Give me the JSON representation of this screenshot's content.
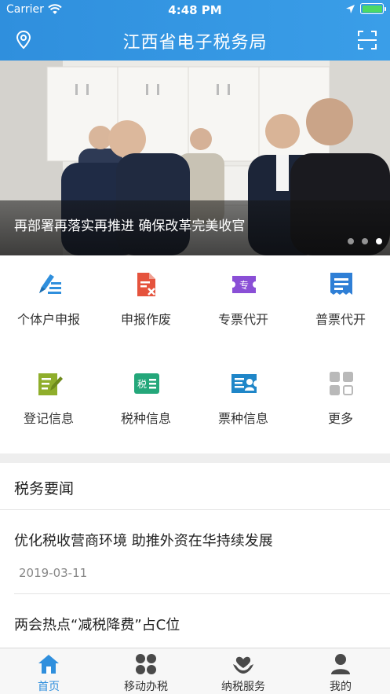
{
  "status_bar": {
    "carrier": "Carrier",
    "time": "4:48 PM"
  },
  "header": {
    "title": "江西省电子税务局",
    "left_icon": "location-pin-icon",
    "right_icon": "scan-icon"
  },
  "banner": {
    "caption": "再部署再落实再推进 确保改革完美收官",
    "slide_count": 3,
    "active_slide": 3
  },
  "services": [
    {
      "label": "个体户申报",
      "icon": "pen-form-icon"
    },
    {
      "label": "申报作废",
      "icon": "document-cancel-icon"
    },
    {
      "label": "专票代开",
      "icon": "special-ticket-icon"
    },
    {
      "label": "普票代开",
      "icon": "receipt-icon"
    },
    {
      "label": "登记信息",
      "icon": "register-edit-icon"
    },
    {
      "label": "税种信息",
      "icon": "tax-type-icon"
    },
    {
      "label": "票种信息",
      "icon": "ticket-type-icon"
    },
    {
      "label": "更多",
      "icon": "more-grid-icon"
    }
  ],
  "news": {
    "heading": "税务要闻",
    "items": [
      {
        "title": "优化税收营商环境 助推外资在华持续发展",
        "date": "2019-03-11"
      },
      {
        "title": "两会热点“减税降费”占C位"
      }
    ]
  },
  "tabs": [
    {
      "label": "首页",
      "icon": "home-icon"
    },
    {
      "label": "移动办税",
      "icon": "apps-icon"
    },
    {
      "label": "纳税服务",
      "icon": "service-hands-icon"
    },
    {
      "label": "我的",
      "icon": "user-icon"
    }
  ],
  "colors": {
    "primary": "#2f8fdd",
    "separator": "#eeeeee",
    "active_tab": "#2f8fdd"
  }
}
